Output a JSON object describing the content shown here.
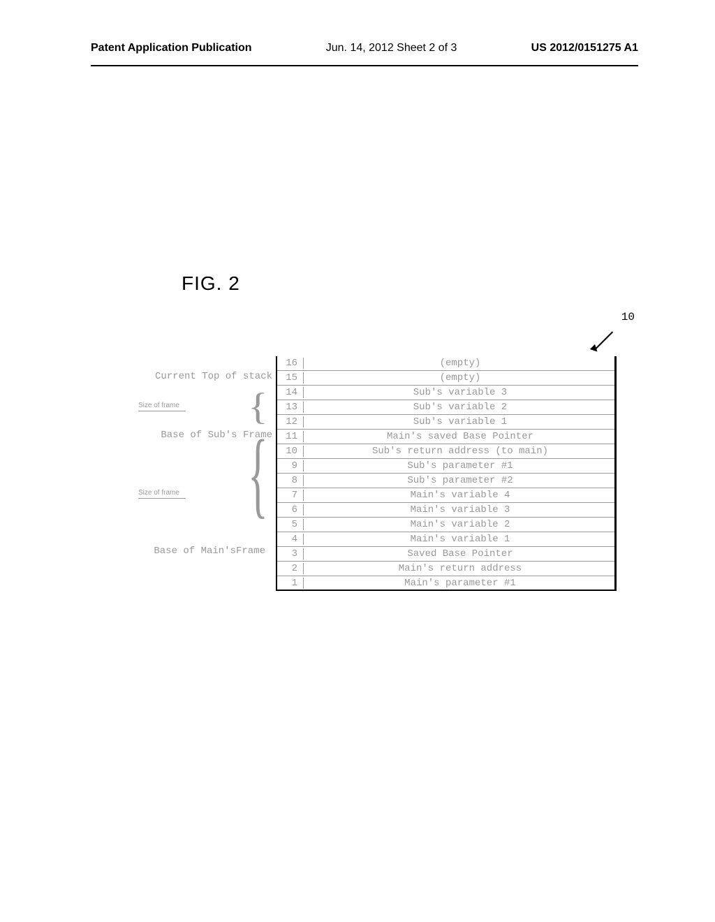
{
  "header": {
    "left": "Patent Application Publication",
    "center": "Jun. 14, 2012  Sheet 2 of 3",
    "right": "US 2012/0151275 A1"
  },
  "figure_label": "FIG. 2",
  "ref_num": "10",
  "labels": {
    "top_of_stack": "Current Top of stack",
    "size_of_frame_1": "Size of frame",
    "base_sub": "Base of Sub's Frame",
    "size_of_frame_2": "Size of frame",
    "base_main": "Base of Main'sFrame"
  },
  "stack": [
    {
      "addr": "16",
      "desc": "(empty)"
    },
    {
      "addr": "15",
      "desc": "(empty)"
    },
    {
      "addr": "14",
      "desc": "Sub's variable 3"
    },
    {
      "addr": "13",
      "desc": "Sub's variable 2"
    },
    {
      "addr": "12",
      "desc": "Sub's variable 1"
    },
    {
      "addr": "11",
      "desc": "Main's saved Base Pointer"
    },
    {
      "addr": "10",
      "desc": "Sub's return address (to main)"
    },
    {
      "addr": "9",
      "desc": "Sub's parameter #1"
    },
    {
      "addr": "8",
      "desc": "Sub's parameter #2"
    },
    {
      "addr": "7",
      "desc": "Main's variable 4"
    },
    {
      "addr": "6",
      "desc": "Main's variable 3"
    },
    {
      "addr": "5",
      "desc": "Main's variable 2"
    },
    {
      "addr": "4",
      "desc": "Main's variable 1"
    },
    {
      "addr": "3",
      "desc": "Saved Base Pointer"
    },
    {
      "addr": "2",
      "desc": "Main's return address"
    },
    {
      "addr": "1",
      "desc": "Main's parameter #1"
    }
  ]
}
